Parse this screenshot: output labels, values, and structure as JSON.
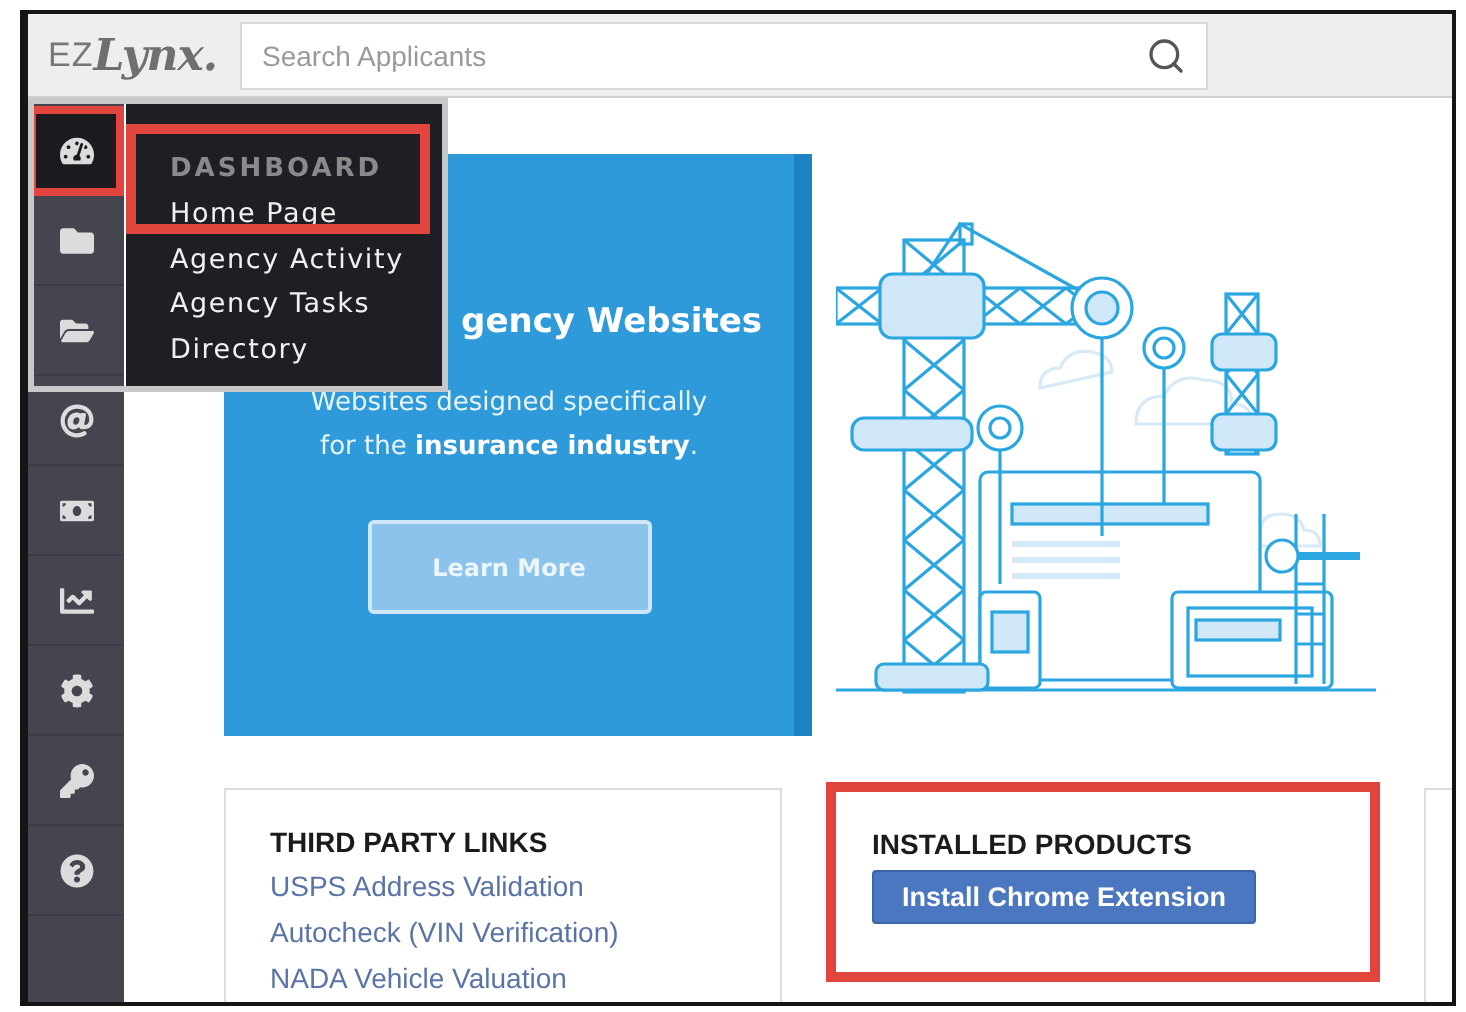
{
  "header": {
    "logo": {
      "prefix": "EZ",
      "name": "Lynx."
    },
    "search": {
      "placeholder": "Search Applicants"
    }
  },
  "sidebar": {
    "items": [
      {
        "kind": "dashboard",
        "selected": true,
        "highlighted": true
      },
      {
        "kind": "folder-person",
        "selected": false,
        "highlighted": false
      },
      {
        "kind": "folder",
        "selected": false,
        "highlighted": false
      },
      {
        "kind": "email",
        "selected": false,
        "highlighted": false
      },
      {
        "kind": "money",
        "selected": false,
        "highlighted": false
      },
      {
        "kind": "chart",
        "selected": false,
        "highlighted": false
      },
      {
        "kind": "settings",
        "selected": false,
        "highlighted": false
      },
      {
        "kind": "key",
        "selected": false,
        "highlighted": false
      },
      {
        "kind": "help",
        "selected": false,
        "highlighted": false
      }
    ]
  },
  "menu": {
    "heading": "DASHBOARD",
    "items": [
      {
        "label": "Home Page",
        "highlighted": true
      },
      {
        "label": "Agency Activity",
        "highlighted": false
      },
      {
        "label": "Agency Tasks",
        "highlighted": false
      },
      {
        "label": "Directory",
        "highlighted": false
      }
    ]
  },
  "banner": {
    "title": "gency Websites",
    "lines": [
      "Websites designed specifically",
      "for the **insurance industry**."
    ],
    "button": "Learn More"
  },
  "third_party_links": {
    "title": "THIRD PARTY LINKS",
    "links": [
      "USPS Address Validation",
      "Autocheck (VIN Verification)",
      "NADA Vehicle Valuation"
    ]
  },
  "installed_products": {
    "title": "INSTALLED PRODUCTS",
    "button": "Install Chrome Extension",
    "highlighted": true
  }
}
